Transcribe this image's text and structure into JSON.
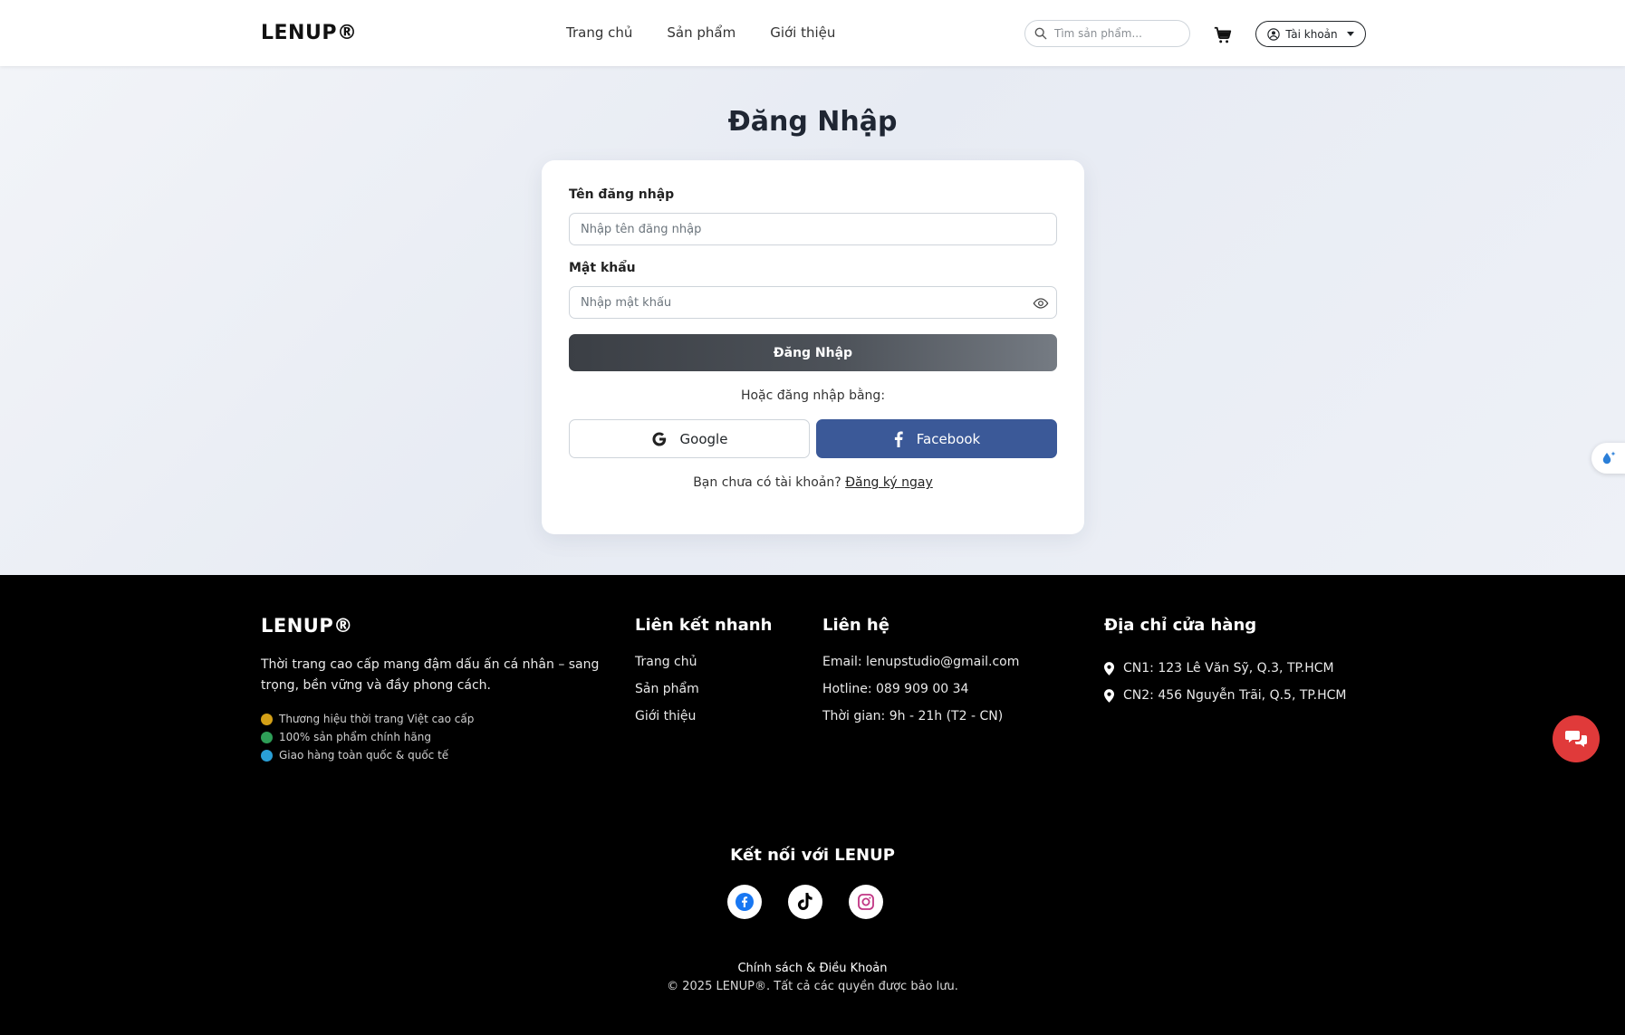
{
  "header": {
    "logo": "LENUP®",
    "nav": [
      "Trang chủ",
      "Sản phẩm",
      "Giới thiệu"
    ],
    "search_placeholder": "Tìm sản phẩm...",
    "account_label": "Tài khoản"
  },
  "login": {
    "title": "Đăng Nhập",
    "username_label": "Tên đăng nhập",
    "username_placeholder": "Nhập tên đăng nhập",
    "password_label": "Mật khẩu",
    "password_placeholder": "Nhập mật khẩu",
    "submit_label": "Đăng Nhập",
    "or_text": "Hoặc đăng nhập bằng:",
    "google_label": "Google",
    "facebook_label": "Facebook",
    "register_prompt": "Bạn chưa có tài khoản?",
    "register_link": "Đăng ký ngay"
  },
  "footer": {
    "logo": "LENUP®",
    "description": "Thời trang cao cấp mang đậm dấu ấn cá nhân – sang trọng, bền vững và đầy phong cách.",
    "features": [
      {
        "text": "Thương hiệu thời trang Việt cao cấp",
        "color": "#d4a017"
      },
      {
        "text": "100% sản phẩm chính hãng",
        "color": "#2e9e57"
      },
      {
        "text": "Giao hàng toàn quốc & quốc tế",
        "color": "#2a9fd6"
      }
    ],
    "quick_links_title": "Liên kết nhanh",
    "quick_links": [
      "Trang chủ",
      "Sản phẩm",
      "Giới thiệu"
    ],
    "contact_title": "Liên hệ",
    "contact": [
      "Email: lenupstudio@gmail.com",
      "Hotline: 089 909 00 34",
      "Thời gian: 9h - 21h (T2 - CN)"
    ],
    "stores_title": "Địa chỉ cửa hàng",
    "stores": [
      "CN1: 123 Lê Văn Sỹ, Q.3, TP.HCM",
      "CN2: 456 Nguyễn Trãi, Q.5, TP.HCM"
    ],
    "connect_title": "Kết nối với LENUP",
    "policy": "Chính sách & Điều Khoản",
    "copyright": "© 2025 LENUP®. Tất cả các quyền được bảo lưu."
  },
  "colors": {
    "facebook": "#3b5998",
    "chat": "#e03a3a",
    "footer_bg": "#000000"
  },
  "icons": [
    "search-icon",
    "cart-icon",
    "user-circle-icon",
    "eye-icon",
    "google-icon",
    "facebook-icon",
    "location-pin-icon",
    "tiktok-icon",
    "instagram-icon",
    "chat-icon",
    "water-drop-icon"
  ]
}
